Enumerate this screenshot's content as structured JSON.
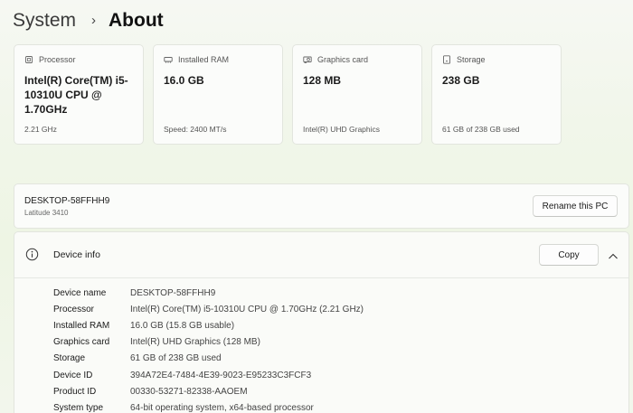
{
  "breadcrumb": {
    "parent": "System",
    "separator": "›",
    "current": "About"
  },
  "cards": [
    {
      "title": "Processor",
      "icon": "processor-icon",
      "value": "Intel(R) Core(TM) i5-10310U CPU @ 1.70GHz",
      "sub": "2.21 GHz"
    },
    {
      "title": "Installed RAM",
      "icon": "ram-icon",
      "value": "16.0 GB",
      "sub": "Speed: 2400 MT/s"
    },
    {
      "title": "Graphics card",
      "icon": "graphics-card-icon",
      "value": "128 MB",
      "sub": "Intel(R) UHD Graphics"
    },
    {
      "title": "Storage",
      "icon": "storage-icon",
      "value": "238 GB",
      "sub": "61 GB of 238 GB used"
    }
  ],
  "pc": {
    "name": "DESKTOP-58FFHH9",
    "model": "Latitude 3410",
    "rename_label": "Rename this PC"
  },
  "device_info": {
    "title": "Device info",
    "copy_label": "Copy",
    "specs": [
      {
        "label": "Device name",
        "value": "DESKTOP-58FFHH9"
      },
      {
        "label": "Processor",
        "value": "Intel(R) Core(TM) i5-10310U CPU @ 1.70GHz (2.21 GHz)"
      },
      {
        "label": "Installed RAM",
        "value": "16.0 GB (15.8 GB usable)"
      },
      {
        "label": "Graphics card",
        "value": "Intel(R) UHD Graphics (128 MB)"
      },
      {
        "label": "Storage",
        "value": "61 GB of 238 GB used"
      },
      {
        "label": "Device ID",
        "value": "394A72E4-7484-4E39-9023-E95233C3FCF3"
      },
      {
        "label": "Product ID",
        "value": "00330-53271-82338-AAOEM"
      },
      {
        "label": "System type",
        "value": "64-bit operating system, x64-based processor"
      }
    ]
  },
  "colors": {
    "card_bg": "#fbfcfa",
    "border": "#e2e5de",
    "page_tint": "#eef5e4"
  }
}
